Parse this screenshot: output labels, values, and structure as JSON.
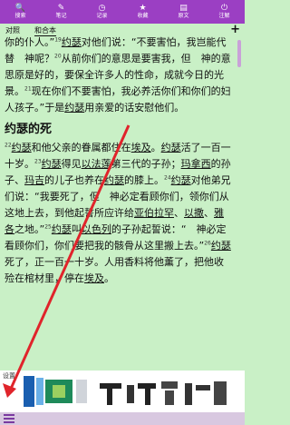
{
  "toolbar": {
    "items": [
      {
        "icon": "magnifier",
        "label": "搜索"
      },
      {
        "icon": "pencil",
        "label": "笔记"
      },
      {
        "icon": "clock",
        "label": "记录"
      },
      {
        "icon": "star",
        "label": "收藏"
      },
      {
        "icon": "document",
        "label": "原文"
      },
      {
        "icon": "power",
        "label": "注解"
      }
    ],
    "glyphs": [
      "🔍",
      "✎",
      "◷",
      "★",
      "▤",
      "⏻"
    ],
    "color": "#9b3fc3"
  },
  "tabs": {
    "compare": "对照",
    "combined": "和合本",
    "add": "+"
  },
  "content": {
    "p1": {
      "t1": "你的仆人。”",
      "n19": "19",
      "joseph1": "约瑟",
      "t2": "对他们说：“不要害怕，我岂能代替　神呢？",
      "n20": "20",
      "t3": "从前你们的意思是要害我，但　神的意思原是好的，要保全许多人的性命，成就今日的光景。",
      "n21": "21",
      "t4": "现在你们不要害怕，我必养活你们和你们的妇人孩子。”于是",
      "joseph2": "约瑟",
      "t5": "用亲爱的话安慰他们。"
    },
    "heading": "约瑟的死",
    "p2": {
      "n22": "22",
      "joseph1": "约瑟",
      "t1": "和他父亲的眷属都住在",
      "egypt1": "埃及",
      "t2": "。",
      "joseph2": "约瑟",
      "t3": "活了一百一十岁。",
      "n23": "23",
      "joseph3": "约瑟",
      "t4": "得见",
      "ephraim": "以法莲",
      "t5": "第三代的子孙；",
      "machir": "玛拿西",
      "t6": "的孙子、",
      "machir2": "玛吉",
      "t7": "的儿子也养在",
      "joseph4": "约瑟",
      "t8": "的膝上。",
      "n24": "24",
      "joseph5": "约瑟",
      "t9": "对他弟兄们说：“我要死了，但　神必定看顾你们，领你们从这地上去，到他起誓所应许给",
      "abraham": "亚伯拉罕",
      "t10": "、",
      "isaac": "以撒",
      "t11": "、",
      "jacob": "雅各",
      "t12": "之地。”",
      "n25": "25",
      "joseph6": "约瑟",
      "t13": "叫",
      "israel": "以色列",
      "t14": "的子孙起誓说：“　神必定看顾你们，你们要把我的骸骨从这里搬上去。”",
      "n26": "26",
      "joseph7": "约瑟",
      "t15": "死了，正一百一十岁。人用香料将他薰了，把他收殓在棺材里，停在",
      "egypt2": "埃及",
      "t16": "。"
    }
  },
  "ad": {
    "label": "设置"
  }
}
